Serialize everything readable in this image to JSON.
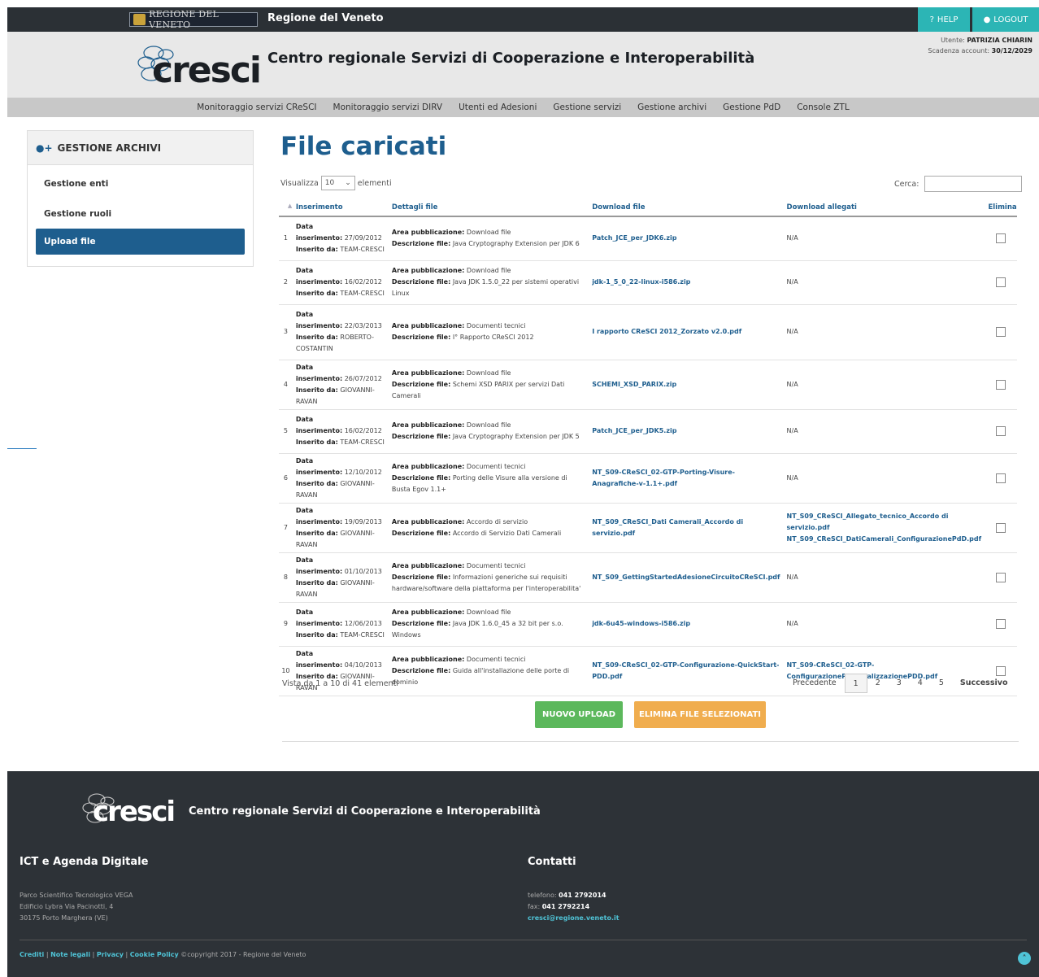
{
  "topbar": {
    "region_logo_text": "REGIONE DEL VENETO",
    "title": "Regione del Veneto",
    "help": "HELP",
    "logout": "LOGOUT"
  },
  "header": {
    "logo_word": "cresci",
    "title": "Centro regionale Servizi di Cooperazione e Interoperabilità",
    "user_label": "Utente:",
    "user_name": "PATRIZIA CHIARIN",
    "expiry_label": "Scadenza account:",
    "expiry_date": "30/12/2029"
  },
  "nav": [
    "Monitoraggio servizi CReSCI",
    "Monitoraggio servizi DIRV",
    "Utenti ed Adesioni",
    "Gestione servizi",
    "Gestione archivi",
    "Gestione PdD",
    "Console ZTL"
  ],
  "sidebar": {
    "title": "GESTIONE ARCHIVI",
    "items": [
      "Gestione enti",
      "Gestione ruoli",
      "Upload file"
    ]
  },
  "main": {
    "title": "File caricati",
    "show_label": "Visualizza",
    "show_value": "10",
    "show_suffix": "elementi",
    "search_label": "Cerca:",
    "columns": [
      "Inserimento",
      "Dettagli file",
      "Download file",
      "Download allegati",
      "Elimina"
    ],
    "rows": [
      {
        "n": "1",
        "data": "27/09/2012",
        "by": "TEAM-CRESCI",
        "area": "Download file",
        "desc": "Java Cryptography Extension per JDK 6",
        "file": "Patch_JCE_per_JDK6.zip",
        "att": "N/A"
      },
      {
        "n": "2",
        "data": "16/02/2012",
        "by": "TEAM-CRESCI",
        "area": "Download file",
        "desc": "Java JDK 1.5.0_22 per sistemi operativi Linux",
        "file": "jdk-1_5_0_22-linux-i586.zip",
        "att": "N/A"
      },
      {
        "n": "3",
        "data": "22/03/2013",
        "by": "ROBERTO-COSTANTIN",
        "area": "Documenti tecnici",
        "desc": "I° Rapporto CReSCI 2012",
        "file": "I rapporto CReSCI 2012_Zorzato v2.0.pdf",
        "att": "N/A"
      },
      {
        "n": "4",
        "data": "26/07/2012",
        "by": "GIOVANNI-RAVAN",
        "area": "Download file",
        "desc": "Schemi XSD PARIX per servizi Dati Camerali",
        "file": "SCHEMI_XSD_PARIX.zip",
        "att": "N/A"
      },
      {
        "n": "5",
        "data": "16/02/2012",
        "by": "TEAM-CRESCI",
        "area": "Download file",
        "desc": "Java Cryptography Extension per JDK 5",
        "file": "Patch_JCE_per_JDK5.zip",
        "att": "N/A"
      },
      {
        "n": "6",
        "data": "12/10/2012",
        "by": "GIOVANNI-RAVAN",
        "area": "Documenti tecnici",
        "desc": "Porting delle Visure alla versione di Busta Egov 1.1+",
        "file": "NT_S09-CReSCI_02-GTP-Porting-Visure-Anagrafiche-v-1.1+.pdf",
        "att": "N/A"
      },
      {
        "n": "7",
        "data": "19/09/2013",
        "by": "GIOVANNI-RAVAN",
        "area": "Accordo di servizio",
        "desc": "Accordo di Servizio Dati Camerali",
        "file": "NT_S09_CReSCI_Dati Camerali_Accordo di servizio.pdf",
        "att": "NT_S09_CReSCI_Allegato_tecnico_Accordo di servizio.pdf NT_S09_CReSCI_DatiCamerali_ConfigurazionePdD.pdf"
      },
      {
        "n": "8",
        "data": "01/10/2013",
        "by": "GIOVANNI-RAVAN",
        "area": "Documenti tecnici",
        "desc": "Informazioni generiche sui requisiti hardware/software della piattaforma per l'interoperabilita'",
        "file": "NT_S09_GettingStartedAdesioneCircuitoCReSCI.pdf",
        "att": "N/A"
      },
      {
        "n": "9",
        "data": "12/06/2013",
        "by": "TEAM-CRESCI",
        "area": "Download file",
        "desc": "Java JDK 1.6.0_45 a 32 bit per s.o. Windows",
        "file": "jdk-6u45-windows-i586.zip",
        "att": "N/A"
      },
      {
        "n": "10",
        "data": "04/10/2013",
        "by": "GIOVANNI-RAVAN",
        "area": "Documenti tecnici",
        "desc": "Guida all'installazione delle porte di dominio",
        "file": "NT_S09-CReSCI_02-GTP-Configurazione-QuickStart-PDD.pdf",
        "att": "NT_S09-CReSCI_02-GTP-ConfigurazionePersonalizzazionePDD.pdf"
      }
    ],
    "info": "Vista da 1 a 10 di 41 elementi",
    "pager": [
      "Precedente",
      "1",
      "2",
      "3",
      "4",
      "5",
      "Successivo"
    ],
    "btn_new": "NUOVO UPLOAD",
    "btn_delete": "ELIMINA FILE SELEZIONATI"
  },
  "labels": {
    "data": "Data",
    "inserimento": "inserimento:",
    "inserito": "Inserito da:",
    "area": "Area pubblicazione:",
    "desc": "Descrizione file:"
  },
  "footer": {
    "logo_word": "cresci",
    "title": "Centro regionale Servizi di Cooperazione e Interoperabilità",
    "col1_title": "ICT e Agenda Digitale",
    "col1_lines": [
      "Parco Scientifico Tecnologico VEGA",
      "Edificio Lybra Via Pacinotti, 4",
      "30175 Porto Marghera (VE)"
    ],
    "col2_title": "Contatti",
    "phone_label": "telefono:",
    "phone": "041 2792014",
    "fax_label": "fax:",
    "fax": "041 2792214",
    "email": "cresci@regione.veneto.it",
    "links": [
      "Crediti",
      "Note legali",
      "Privacy",
      "Cookie Policy"
    ],
    "copyright": "©copyright 2017 - Regione del Veneto"
  }
}
